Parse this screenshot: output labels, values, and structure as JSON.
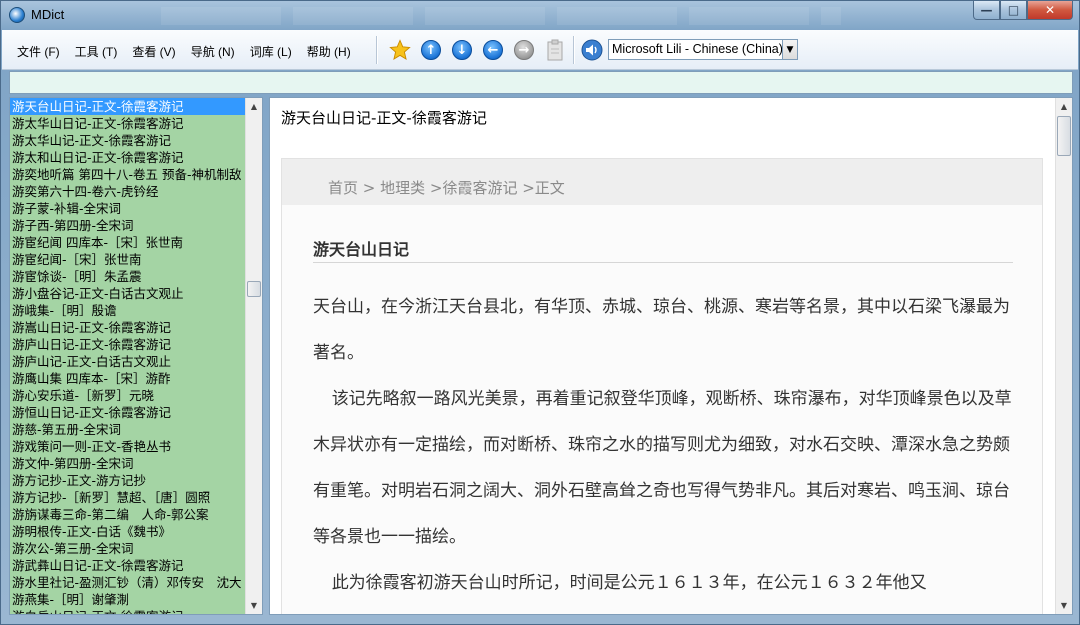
{
  "window": {
    "title": "MDict"
  },
  "menu": [
    "文件 (F)",
    "工具 (T)",
    "查看 (V)",
    "导航 (N)",
    "词库 (L)",
    "帮助 (H)"
  ],
  "toolbar": {
    "voice": "Microsoft Lili - Chinese (China)"
  },
  "search": {
    "value": ""
  },
  "wordlist": {
    "items": [
      "游天台山日记-正文-徐霞客游记",
      "游太华山日记-正文-徐霞客游记",
      "游太华山记-正文-徐霞客游记",
      "游太和山日记-正文-徐霞客游记",
      "游奕地听篇 第四十八-卷五 预备-神机制敌",
      "游奕第六十四-卷六-虎钤经",
      "游子蒙-补辑-全宋词",
      "游子西-第四册-全宋词",
      "游宦纪闻 四库本-［宋］张世南",
      "游宦纪闻-［宋］张世南",
      "游宦馀谈-［明］朱孟震",
      "游小盘谷记-正文-白话古文观止",
      "游峨集-［明］殷谵",
      "游嵩山日记-正文-徐霞客游记",
      "游庐山日记-正文-徐霞客游记",
      "游庐山记-正文-白话古文观止",
      "游鹰山集 四库本-［宋］游酢",
      "游心安乐道-［新罗］元晓",
      "游恒山日记-正文-徐霞客游记",
      "游慈-第五册-全宋词",
      "游戏策问一则-正文-香艳丛书",
      "游文仲-第四册-全宋词",
      "游方记抄-正文-游方记抄",
      "游方记抄-［新罗］慧超、［唐］圆照",
      "游旃谋毒三命-第二编　人命-郭公案",
      "游明根传-正文-白话《魏书》",
      "游次公-第三册-全宋词",
      "游武彝山日记-正文-徐霞客游记",
      "游水里社记-盈测汇钞（清）邓传安　沈大",
      "游燕集-［明］谢肇淛",
      "游白岳山日记-正文-徐霞客游记"
    ]
  },
  "entry": {
    "headword": "游天台山日记-正文-徐霞客游记",
    "breadcrumb": "首页 > 地理类 >徐霞客游记 >正文",
    "title": "游天台山日记",
    "paragraphs": [
      "天台山，在今浙江天台县北，有华顶、赤城、琼台、桃源、寒岩等名景，其中以石梁飞瀑最为著名。",
      "该记先略叙一路风光美景，再着重记叙登华顶峰，观断桥、珠帘瀑布，对华顶峰景色以及草木异状亦有一定描绘，而对断桥、珠帘之水的描写则尤为细致，对水石交映、潭深水急之势颇有重笔。对明岩石洞之阔大、洞外石壁高耸之奇也写得气势非凡。其后对寒岩、鸣玉涧、琼台等各景也一一描绘。",
      "此为徐霞客初游天台山时所记，时间是公元１６１３年，在公元１６３２年他又"
    ]
  }
}
